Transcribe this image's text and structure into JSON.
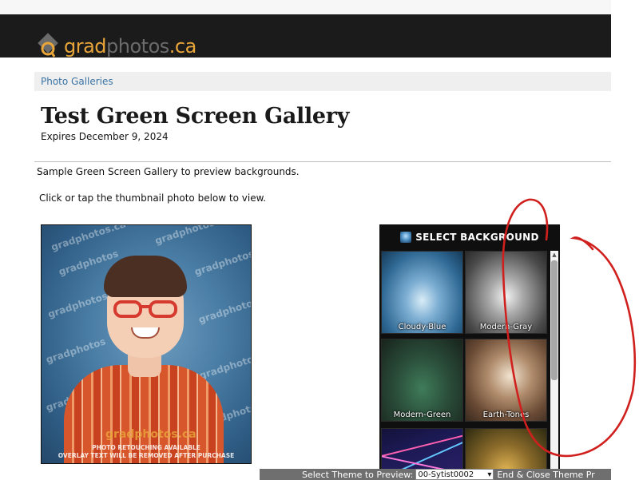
{
  "header": {
    "logo": {
      "part1": "grad",
      "part2": "photos",
      "part3": ".ca"
    }
  },
  "breadcrumb": {
    "link": "Photo Galleries"
  },
  "gallery": {
    "title": "Test Green Screen Gallery",
    "expires": "Expires December 9, 2024",
    "description": "Sample Green Screen Gallery to preview backgrounds.",
    "instruction": "Click or tap the thumbnail photo below to view."
  },
  "photo": {
    "watermark": "gradphotos.ca",
    "watermark_short": "gradphotos",
    "retouch_line1": "PHOTO RETOUCHING AVAILABLE",
    "retouch_line2": "OVERLAY TEXT WILL BE REMOVED AFTER PURCHASE"
  },
  "background_panel": {
    "title": "SELECT BACKGROUND",
    "items": [
      {
        "label": "Cloudy-Blue"
      },
      {
        "label": "Modern-Gray"
      },
      {
        "label": "Modern-Green"
      },
      {
        "label": "Earth-Tones"
      },
      {
        "label": ""
      },
      {
        "label": ""
      }
    ]
  },
  "bottom_bar": {
    "select_label": "Select Theme to Preview:",
    "selected_theme": "00-Sytist0002",
    "end_button": "End & Close Theme Pr"
  },
  "colors": {
    "header_bg": "#1b1b1b",
    "logo_orange": "#e8a53a",
    "link_blue": "#3b74a6",
    "annotation_red": "#d0201e"
  }
}
